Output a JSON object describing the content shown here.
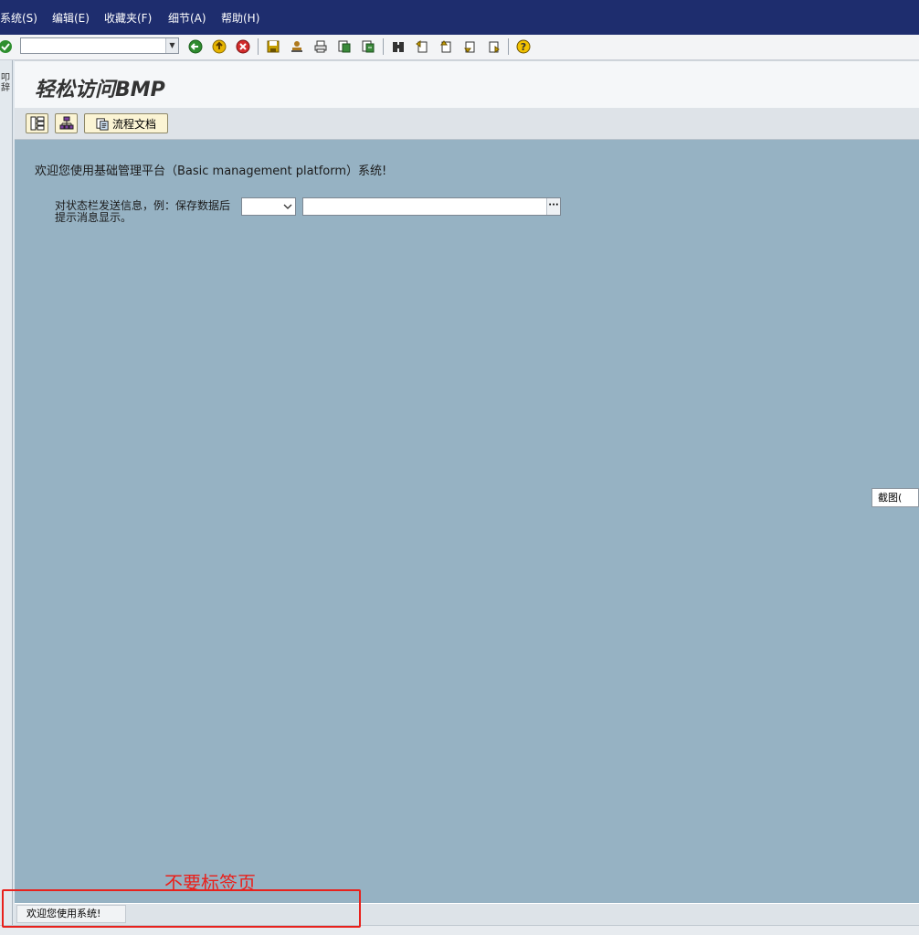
{
  "menu": {
    "items": [
      {
        "label": "系统(S)"
      },
      {
        "label": "编辑(E)"
      },
      {
        "label": "收藏夹(F)"
      },
      {
        "label": "细节(A)"
      },
      {
        "label": "帮助(H)"
      }
    ]
  },
  "toolbar": {
    "command_field": {
      "value": "",
      "placeholder": ""
    }
  },
  "left_strip": {
    "text": "叩辞"
  },
  "page": {
    "title": "轻松访问BMP"
  },
  "app_toolbar": {
    "process_doc_label": "流程文档"
  },
  "main": {
    "welcome_text": "欢迎您使用基础管理平台（Basic management platform）系统!",
    "status_label": "对状态栏发送信息，例：保存数据后提示消息显示。",
    "message_type_value": "",
    "message_text_value": "",
    "more_button_label": "···"
  },
  "tooltip": {
    "text": "截图("
  },
  "bottom": {
    "tab_label": "欢迎您使用系统!"
  },
  "annotation": {
    "text": "不要标签页"
  },
  "colors": {
    "menubar": "#1e2d6e",
    "main_bg": "#96b2c3",
    "annotation": "#e8211c",
    "button_bg": "#fbf4d4"
  }
}
